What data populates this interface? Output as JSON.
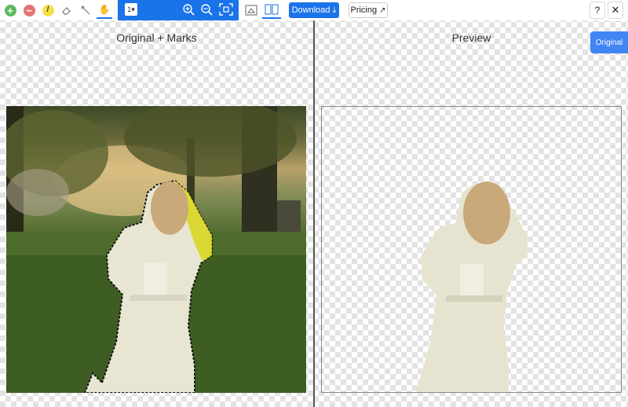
{
  "toolbar": {
    "tools": [
      {
        "name": "add-mark",
        "icon": "plus-circle-icon",
        "color": "#5cb85c",
        "glyph": "+"
      },
      {
        "name": "remove-mark",
        "icon": "minus-circle-icon",
        "color": "#e57373",
        "glyph": "−"
      },
      {
        "name": "pencil",
        "icon": "pencil-icon",
        "color": "#f4e04d",
        "glyph": "/"
      },
      {
        "name": "eraser",
        "icon": "eraser-icon",
        "color": "#888888",
        "glyph": ""
      },
      {
        "name": "lasso",
        "icon": "lasso-icon",
        "color": "#888888",
        "glyph": ""
      },
      {
        "name": "pan",
        "icon": "hand-icon",
        "color": "#333333",
        "glyph": "✋"
      }
    ],
    "brush_size_value": "1",
    "zoom_in_icon": "zoom-in-icon",
    "zoom_out_icon": "zoom-out-icon",
    "fit_icon": "fit-screen-icon",
    "view_single_icon": "single-view-icon",
    "view_split_icon": "split-view-icon",
    "download_label": "Download",
    "pricing_label": "Pricing",
    "help_label": "?",
    "close_label": "✕",
    "accent": "#1a73e8"
  },
  "panels": {
    "left_title": "Original + Marks",
    "right_title": "Preview"
  },
  "side_button_label": "Original"
}
